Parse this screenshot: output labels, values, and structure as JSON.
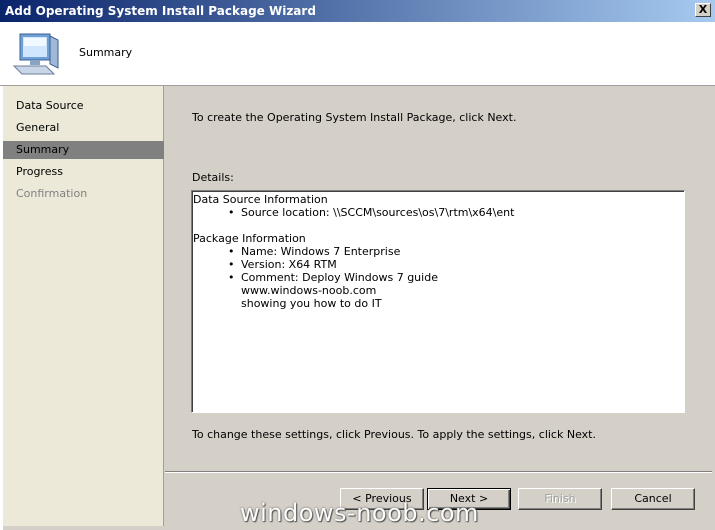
{
  "window": {
    "title": "Add Operating System Install Package Wizard",
    "close_label": "X"
  },
  "header": {
    "title": "Summary",
    "icon": "computer-icon"
  },
  "nav": {
    "items": [
      {
        "label": "Data Source",
        "state": "normal"
      },
      {
        "label": "General",
        "state": "normal"
      },
      {
        "label": "Summary",
        "state": "active"
      },
      {
        "label": "Progress",
        "state": "normal"
      },
      {
        "label": "Confirmation",
        "state": "disabled"
      }
    ]
  },
  "content": {
    "intro": "To create the Operating System Install Package, click Next.",
    "details_label": "Details:",
    "details": {
      "data_source_title": "Data Source Information",
      "source_location": "Source location: \\\\SCCM\\sources\\os\\7\\rtm\\x64\\ent",
      "package_title": "Package Information",
      "name": "Name: Windows 7 Enterprise",
      "version": "Version: X64 RTM",
      "comment": "Comment: Deploy Windows 7 guide",
      "comment_line2": "www.windows-noob.com",
      "comment_line3": "showing you how to do IT"
    },
    "footer": "To change these settings, click Previous. To apply the settings, click Next."
  },
  "buttons": {
    "previous": "< Previous",
    "next": "Next >",
    "finish": "Finish",
    "cancel": "Cancel"
  },
  "watermark": "windows-noob.com"
}
